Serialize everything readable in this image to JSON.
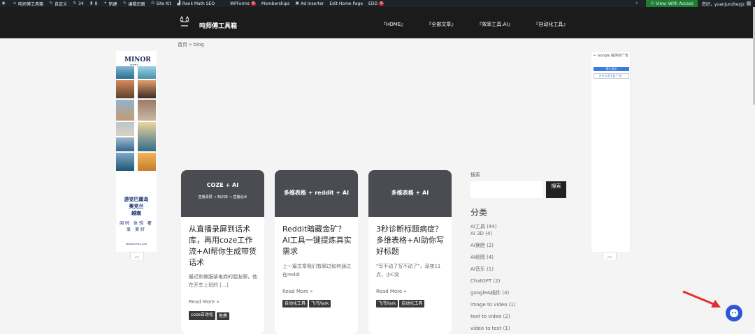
{
  "admin_bar": {
    "site": "吨师傅工具箱",
    "customize": "自定义",
    "updates": "34",
    "comments": "8",
    "new": "新建",
    "edit_page": "编辑页面",
    "site_kit": "Site Kit",
    "rank_math": "Rank Math SEO",
    "wpforms": "WPForms",
    "wpforms_badge": "5",
    "memberships": "Memberships",
    "ad_inserter": "Ad Inserter",
    "edit_home": "Edit Home Page",
    "edd": "EDD",
    "edd_badge": "5",
    "view_with_access": "View: With Access",
    "greeting": "您好，yuanjunzheyjz"
  },
  "header": {
    "site_name": "吨师傅工具箱",
    "nav": [
      "『HOME』",
      "『全部文章』",
      "『效率工具.AI』",
      "『自动化工具』"
    ]
  },
  "breadcrumb": "首页 » blog",
  "ad_left": {
    "brand": "MINOR",
    "sub": "HOTELS",
    "line1": "游览巴厘岛",
    "line2": "奥克兰",
    "line3": "越南",
    "line4": "阅时 体验 奢享 美好",
    "url": "MINORHOTELS.COM"
  },
  "ad_right": {
    "google": "Google 提供的广告",
    "stop": "停止显示",
    "why": "为什么显示此广告？"
  },
  "cards": [
    {
      "thumb_title": "COZE + AI",
      "thumb_sub": "直播录屏 → 知识库 → 直播话术",
      "title": "从直播录屏到话术库，再用coze工作流+AI帮你生成带货话术",
      "excerpt": "最近和做服装电商的朋友聊，他在开车上班的 […]",
      "more": "Read More »",
      "tags": [
        "coze自动化",
        "免费"
      ]
    },
    {
      "thumb_title": "多维表格 + reddit + AI",
      "thumb_sub": "",
      "title": "Reddit暗藏金矿？AI工具一键提炼真实需求",
      "excerpt": "上一篇文章我们有聊过如何通过在reddi",
      "more": "Read More »",
      "tags": [
        "自动化工具",
        "飞书/lark"
      ]
    },
    {
      "thumb_title": "多维表格 + AI",
      "thumb_sub": "",
      "title": "3秒诊断标题病症？多维表格+AI助你写好标题",
      "excerpt": "\"写不动了写不动了\"，深夜11点，小C突",
      "more": "Read More »",
      "tags": [
        "飞书/lark",
        "自动化工具"
      ]
    }
  ],
  "sidebar": {
    "search_label": "搜索",
    "search_button": "搜索",
    "search_placeholder": "",
    "categories_title": "分类",
    "categories": [
      "AI工具 (44)",
      "AI 3D (4)",
      "AI换脸 (2)",
      "AI绘图 (4)",
      "AI音乐 (1)",
      "ChatGPT (2)",
      "google&插件 (4)",
      "image to video (1)",
      "text to video (2)",
      "video to text (1)"
    ]
  },
  "colors": {
    "admin_bg": "#1d2327",
    "header_bg": "#1b1b1b",
    "card_thumb": "#4a4c52",
    "accent_red": "#e03131",
    "chat_blue": "#2f56d6"
  }
}
